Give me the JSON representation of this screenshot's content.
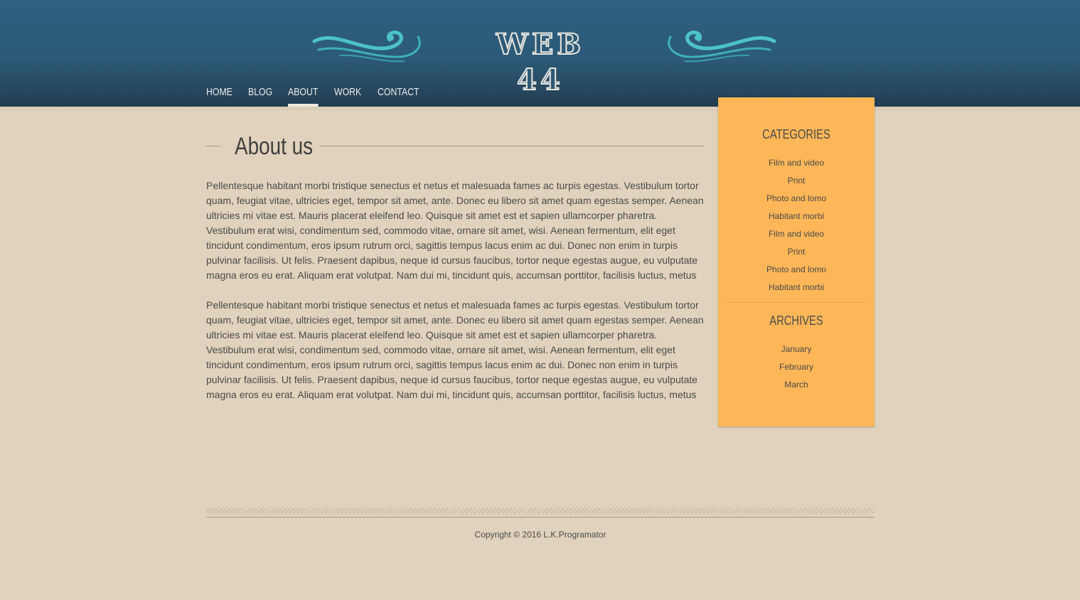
{
  "header": {
    "logo_text": "WEB 44"
  },
  "nav": {
    "items": [
      {
        "label": "HOME"
      },
      {
        "label": "BLOG"
      },
      {
        "label": "ABOUT"
      },
      {
        "label": "WORK"
      },
      {
        "label": "CONTACT"
      }
    ],
    "active": "ABOUT"
  },
  "main": {
    "title": "About us",
    "paragraphs": [
      "Pellentesque habitant morbi tristique senectus et netus et malesuada fames ac turpis egestas. Vestibulum tortor quam, feugiat vitae, ultricies eget, tempor sit amet, ante. Donec eu libero sit amet quam egestas semper. Aenean ultricies mi vitae est. Mauris placerat eleifend leo. Quisque sit amet est et sapien ullamcorper pharetra. Vestibulum erat wisi, condimentum sed, commodo vitae, ornare sit amet, wisi. Aenean fermentum, elit eget tincidunt condimentum, eros ipsum rutrum orci, sagittis tempus lacus enim ac dui. Donec non enim in turpis pulvinar facilisis. Ut felis. Praesent dapibus, neque id cursus faucibus, tortor neque egestas augue, eu vulputate magna eros eu erat. Aliquam erat volutpat. Nam dui mi, tincidunt quis, accumsan porttitor, facilisis luctus, metus",
      "Pellentesque habitant morbi tristique senectus et netus et malesuada fames ac turpis egestas. Vestibulum tortor quam, feugiat vitae, ultricies eget, tempor sit amet, ante. Donec eu libero sit amet quam egestas semper. Aenean ultricies mi vitae est. Mauris placerat eleifend leo. Quisque sit amet est et sapien ullamcorper pharetra. Vestibulum erat wisi, condimentum sed, commodo vitae, ornare sit amet, wisi. Aenean fermentum, elit eget tincidunt condimentum, eros ipsum rutrum orci, sagittis tempus lacus enim ac dui. Donec non enim in turpis pulvinar facilisis. Ut felis. Praesent dapibus, neque id cursus faucibus, tortor neque egestas augue, eu vulputate magna eros eu erat. Aliquam erat volutpat. Nam dui mi, tincidunt quis, accumsan porttitor, facilisis luctus, metus"
    ]
  },
  "sidebar": {
    "categories_title": "CATEGORIES",
    "categories": [
      "Film and video",
      "Print",
      "Photo and lomo",
      "Habitant morbi",
      "Film and video",
      "Print",
      "Photo and lomo",
      "Habitant morbi"
    ],
    "archives_title": "ARCHIVES",
    "archives": [
      "January",
      "February",
      "March"
    ]
  },
  "footer": {
    "copyright": "Copyright © 2016 L.K.Programator"
  },
  "colors": {
    "header_blue": "#2f607f",
    "page_background": "#e0d2bc",
    "sidebar_orange": "#fdb758",
    "swirl_teal": "#4cc3c8"
  }
}
